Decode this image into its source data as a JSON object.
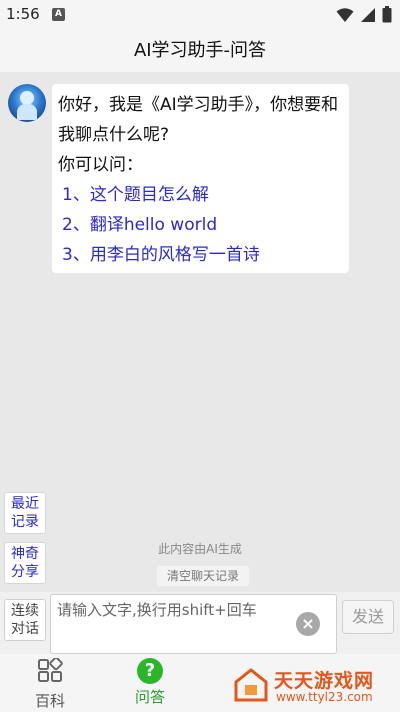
{
  "status_bar": {
    "time": "1:56",
    "notif_icon": "A"
  },
  "header": {
    "title": "AI学习助手-问答"
  },
  "chat": {
    "greeting": "你好，我是《AI学习助手》，你想要和我聊点什么呢?",
    "prompt": "你可以问：",
    "suggestions": [
      "1、这个题目怎么解",
      "2、翻译hello world",
      "3、用李白的风格写一首诗"
    ]
  },
  "side_buttons": {
    "recent": [
      "最近",
      "记录"
    ],
    "magic": [
      "神奇",
      "分享"
    ]
  },
  "ai_note": "此内容由AI生成",
  "clear_chat": "清空聊天记录",
  "input_bar": {
    "continuous": [
      "连续",
      "对话"
    ],
    "placeholder": "请输入文字,换行用shift+回车",
    "send": "发送"
  },
  "bottom_nav": {
    "baike": "百科",
    "wenda": "问答",
    "wenda_icon": "?"
  },
  "watermark": {
    "title": "天天游戏网",
    "url": "www.ttyl23.com"
  },
  "colors": {
    "accent_blue": "#2a2acd",
    "nav_active": "#2bb52b",
    "watermark": "#e2571b"
  }
}
